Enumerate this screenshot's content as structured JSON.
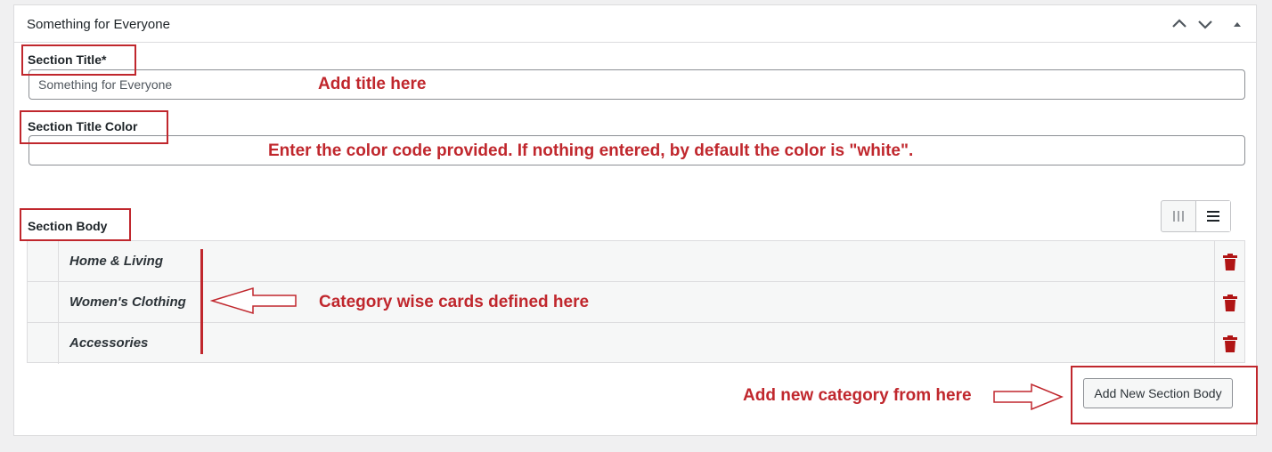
{
  "panel": {
    "title": "Something for Everyone",
    "icons": [
      "chevron-up-icon",
      "chevron-down-icon",
      "triangle-up-icon"
    ]
  },
  "fields": {
    "section_title": {
      "label": "Section Title*",
      "value": "Something for Everyone"
    },
    "section_title_color": {
      "label": "Section Title Color",
      "value": ""
    },
    "section_body": {
      "label": "Section Body"
    }
  },
  "section_body_rows": [
    {
      "label": "Home & Living"
    },
    {
      "label": "Women's Clothing"
    },
    {
      "label": "Accessories"
    }
  ],
  "view_toggle": {
    "icons": [
      "columns-icon",
      "rows-icon"
    ],
    "active": "rows-icon"
  },
  "add_button_label": "Add New Section Body",
  "annotations": {
    "title_note": "Add title here",
    "color_note": "Enter the color code provided. If nothing entered, by default the color is \"white\".",
    "cards_note": "Category wise cards defined here",
    "add_note": "Add new category from here"
  },
  "colors": {
    "annotation": "#c0272d",
    "trash": "#b01414",
    "border": "#dcdcde"
  }
}
